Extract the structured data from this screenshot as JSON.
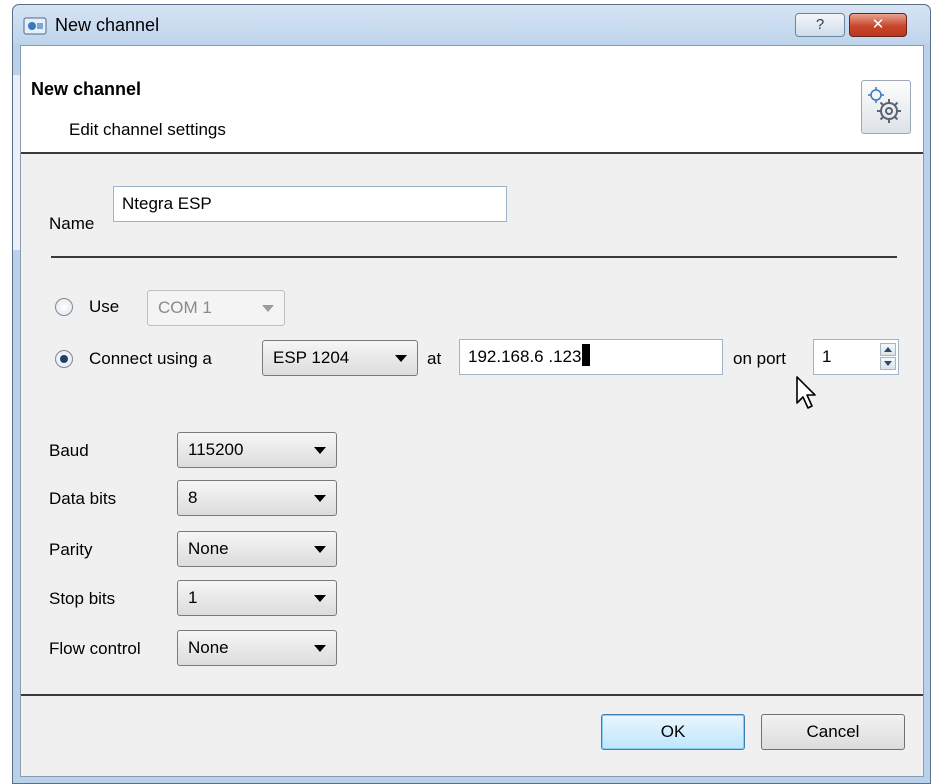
{
  "window": {
    "title": "New channel",
    "help_glyph": "?",
    "close_glyph": "✕"
  },
  "header": {
    "title": "New channel",
    "subtitle": "Edit channel settings",
    "icon": "settings-gear-icon"
  },
  "form": {
    "name_label": "Name",
    "name_value": "Ntegra ESP",
    "use_label": "Use",
    "com_value": "COM 1",
    "connect_label": "Connect using a",
    "device_value": "ESP 1204",
    "at_label": "at",
    "ip_value": "192.168.6 .123",
    "port_label": "on port",
    "port_value": "1",
    "connection_mode": "connect-using"
  },
  "serial": {
    "baud_label": "Baud",
    "baud_value": "115200",
    "databits_label": "Data bits",
    "databits_value": "8",
    "parity_label": "Parity",
    "parity_value": "None",
    "stopbits_label": "Stop bits",
    "stopbits_value": "1",
    "flow_label": "Flow control",
    "flow_value": "None"
  },
  "buttons": {
    "ok": "OK",
    "cancel": "Cancel"
  },
  "colors": {
    "frame": "#b9d1ea",
    "close_button": "#c9462c",
    "default_button_border": "#3c7fb1"
  }
}
